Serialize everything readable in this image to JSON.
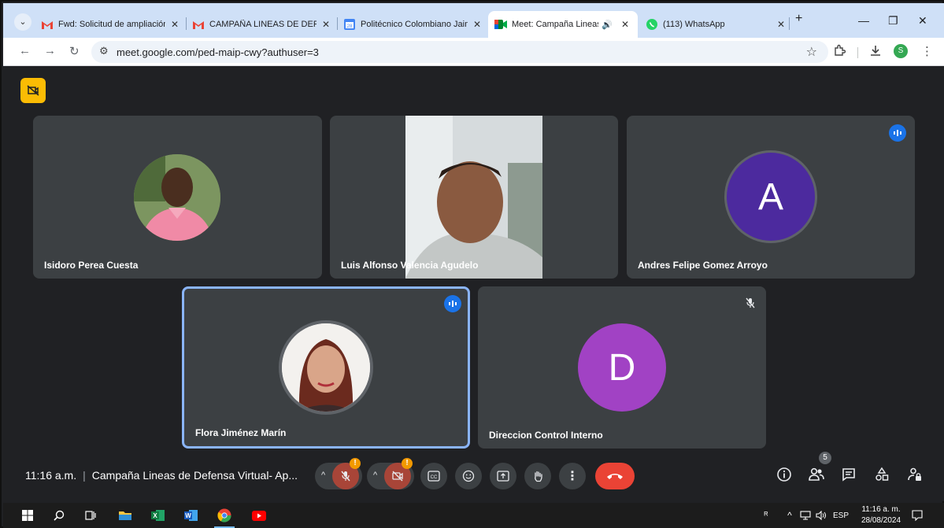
{
  "tabs": [
    {
      "title": "Fwd: Solicitud de ampliación",
      "icon": "gmail-icon"
    },
    {
      "title": "CAMPAÑA LINEAS DE DEFEN",
      "icon": "gmail-icon"
    },
    {
      "title": "Politécnico Colombiano Jaim",
      "icon": "calendar-icon"
    },
    {
      "title": "Meet: Campaña Lineas d",
      "icon": "meet-icon",
      "active": true
    },
    {
      "title": "(113) WhatsApp",
      "icon": "whatsapp-icon"
    }
  ],
  "address": {
    "url": "meet.google.com/ped-maip-cwy?authuser=3"
  },
  "profile": {
    "initial": "S",
    "color": "#34a853"
  },
  "participants": [
    {
      "name": "Isidoro Perea Cuesta",
      "kind": "photo"
    },
    {
      "name": "Luis Alfonso Valencia Agudelo",
      "kind": "video"
    },
    {
      "name": "Andres Felipe Gomez Arroyo",
      "kind": "letter",
      "letter": "A",
      "color": "#4c2a9e",
      "speaking": true
    },
    {
      "name": "Flora Jiménez Marín",
      "kind": "photo",
      "speaking": true
    },
    {
      "name": "Direccion Control Interno",
      "kind": "letter",
      "letter": "D",
      "color": "#a142c4",
      "muted": true
    }
  ],
  "meeting": {
    "time": "11:16 a.m.",
    "title": "Campaña Lineas de Defensa Virtual- Ap...",
    "people_count": "5"
  },
  "taskbar": {
    "lang": "ESP",
    "time": "11:16 a. m.",
    "date": "28/08/2024"
  },
  "colors": {
    "accent": "#1a73e8",
    "end_call": "#ea4335",
    "warning": "#f29900",
    "record": "#fbbc04"
  }
}
